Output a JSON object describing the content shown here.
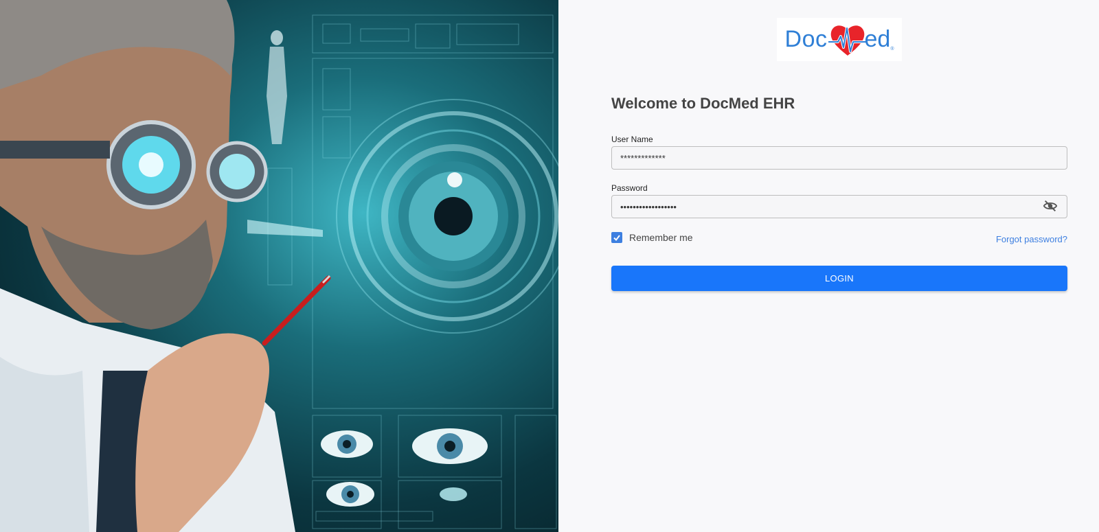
{
  "brand": {
    "logo_doc": "Doc",
    "logo_ed": "ed",
    "logo_reg": "®",
    "primary_color": "#1976fa",
    "logo_color": "#2f7fd6",
    "heart_color": "#e8242a"
  },
  "login": {
    "title": "Welcome to DocMed EHR",
    "username_label": "User Name",
    "username_value": "*************",
    "password_label": "Password",
    "password_value": "••••••••••••••••••",
    "remember_label": "Remember me",
    "remember_checked": true,
    "forgot_label": "Forgot password?",
    "login_label": "LOGIN"
  },
  "icons": {
    "password_toggle": "eye-off-icon",
    "remember_check": "check-icon"
  }
}
